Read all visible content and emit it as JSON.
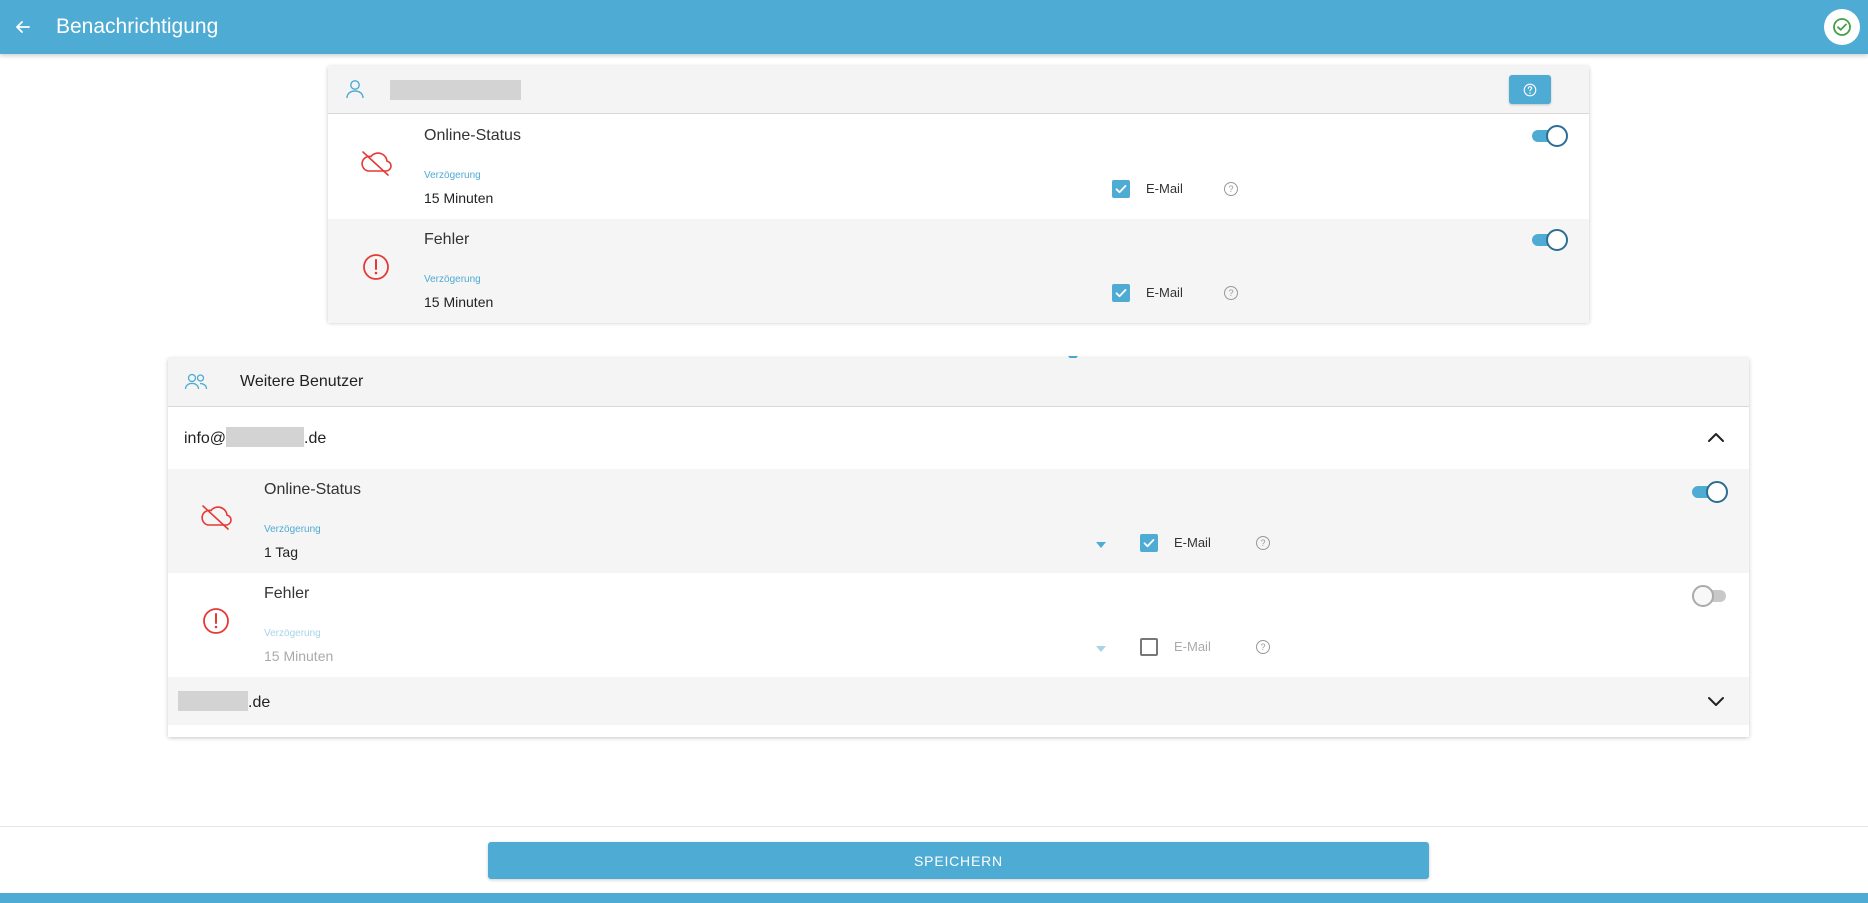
{
  "header": {
    "title": "Benachrichtigung",
    "back_icon": "arrow-left-icon",
    "status_icon": "check-circle-icon"
  },
  "own_user": {
    "user_icon": "person-icon",
    "help_icon": "help-circle-icon",
    "rows": [
      {
        "title": "Online-Status",
        "icon": "cloud-off-icon",
        "delay_label": "Verzögerung",
        "delay_value": "15 Minuten",
        "email_label": "E-Mail",
        "email_checked": true,
        "enabled": true
      },
      {
        "title": "Fehler",
        "icon": "error-alert-icon",
        "delay_label": "Verzögerung",
        "delay_value": "15 Minuten",
        "email_label": "E-Mail",
        "email_checked": true,
        "enabled": true
      }
    ]
  },
  "other_users": {
    "title": "Weitere Benutzer",
    "icon": "people-icon",
    "users": [
      {
        "email_prefix": "info@",
        "email_suffix": ".de",
        "expanded": true,
        "rows": [
          {
            "title": "Online-Status",
            "icon": "cloud-off-icon",
            "delay_label": "Verzögerung",
            "delay_value": "1 Tag",
            "email_label": "E-Mail",
            "email_checked": true,
            "enabled": true
          },
          {
            "title": "Fehler",
            "icon": "error-alert-icon",
            "delay_label": "Verzögerung",
            "delay_value": "15 Minuten",
            "email_label": "E-Mail",
            "email_checked": false,
            "enabled": false
          }
        ]
      },
      {
        "email_prefix": "",
        "email_suffix": ".de",
        "expanded": false
      }
    ]
  },
  "footer": {
    "save_label": "SPEICHERN"
  },
  "colors": {
    "primary": "#4eabd4",
    "error": "#e53935",
    "toggle_knob_border": "#2c6e93",
    "success": "#43a047"
  }
}
